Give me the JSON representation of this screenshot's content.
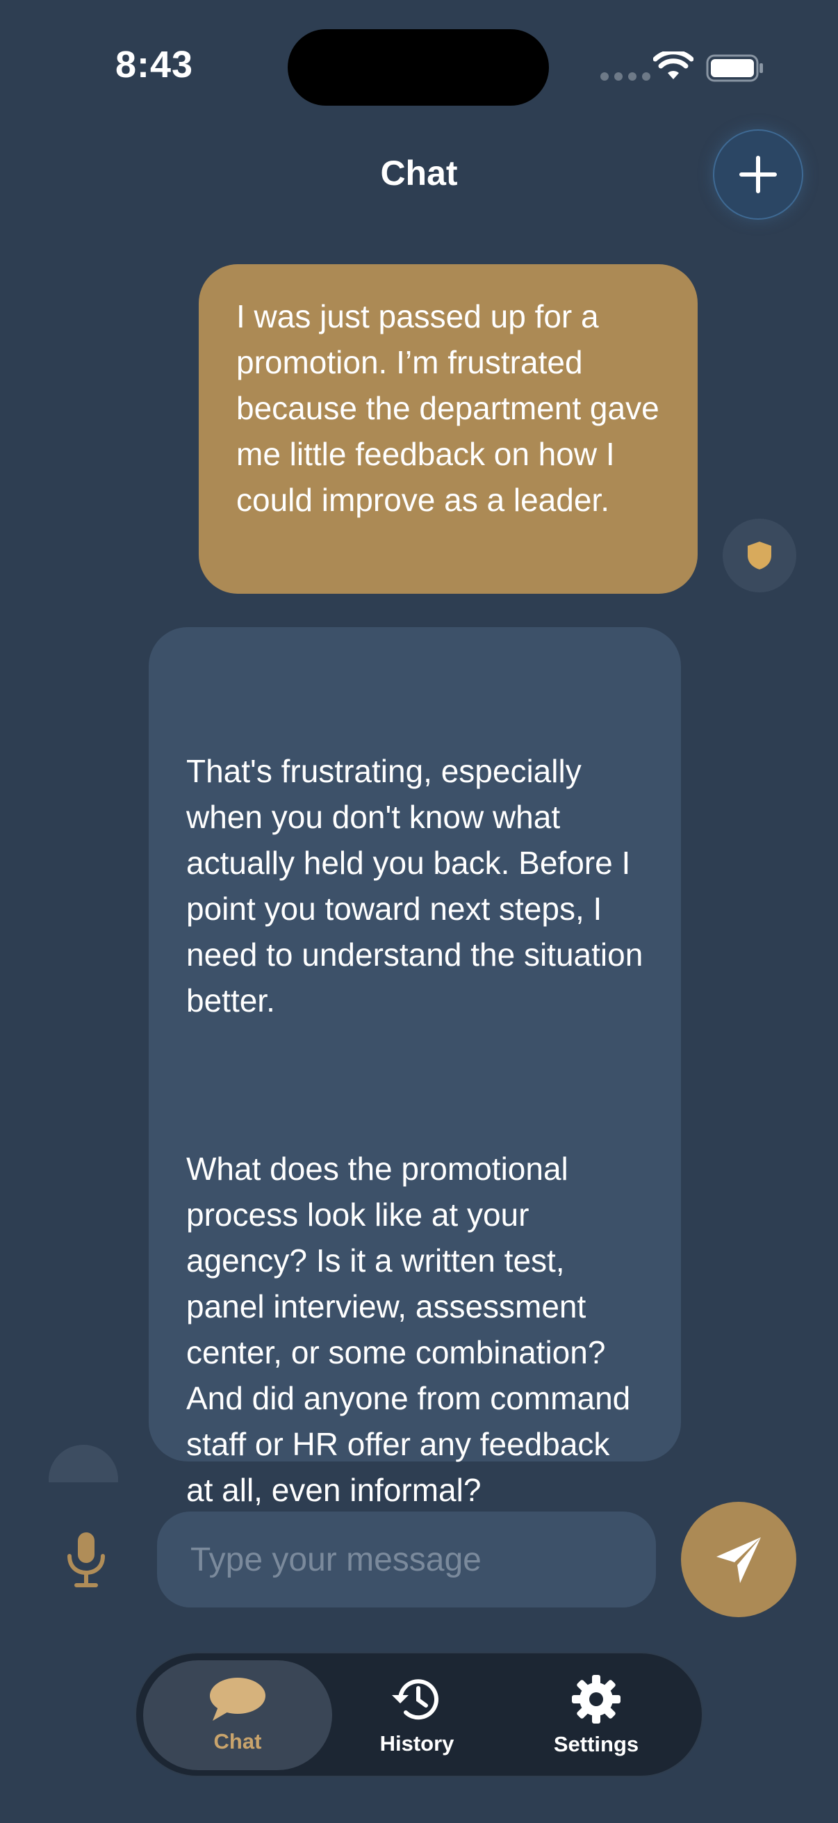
{
  "status_bar": {
    "time": "8:43"
  },
  "header": {
    "title": "Chat",
    "new_chat_icon": "plus-icon"
  },
  "colors": {
    "background": "#2e3e52",
    "user_bubble": "#ac8a55",
    "assistant_bubble": "#3d5169",
    "accent": "#c9a46c"
  },
  "messages": [
    {
      "role": "user",
      "text": "I was just passed up for a promotion. I’m frustrated because the department gave me little feedback on how I could improve as a leader.",
      "badge_icon": "shield-icon"
    },
    {
      "role": "assistant",
      "paragraphs": [
        "That's frustrating, especially when you don't know what actually held you back. Before I point you toward next steps, I need to understand the situation better.",
        "What does the promotional process look like at your agency? Is it a written test, panel interview, assessment center, or some combination? And did anyone from command staff or HR offer any feedback at all, even informal?"
      ]
    }
  ],
  "composer": {
    "placeholder": "Type your message",
    "value": "",
    "mic_icon": "microphone-icon",
    "send_icon": "paper-plane-icon"
  },
  "tabs": [
    {
      "label": "Chat",
      "icon": "chat-bubble-icon",
      "active": true
    },
    {
      "label": "History",
      "icon": "clock-history-icon",
      "active": false
    },
    {
      "label": "Settings",
      "icon": "gear-icon",
      "active": false
    }
  ]
}
